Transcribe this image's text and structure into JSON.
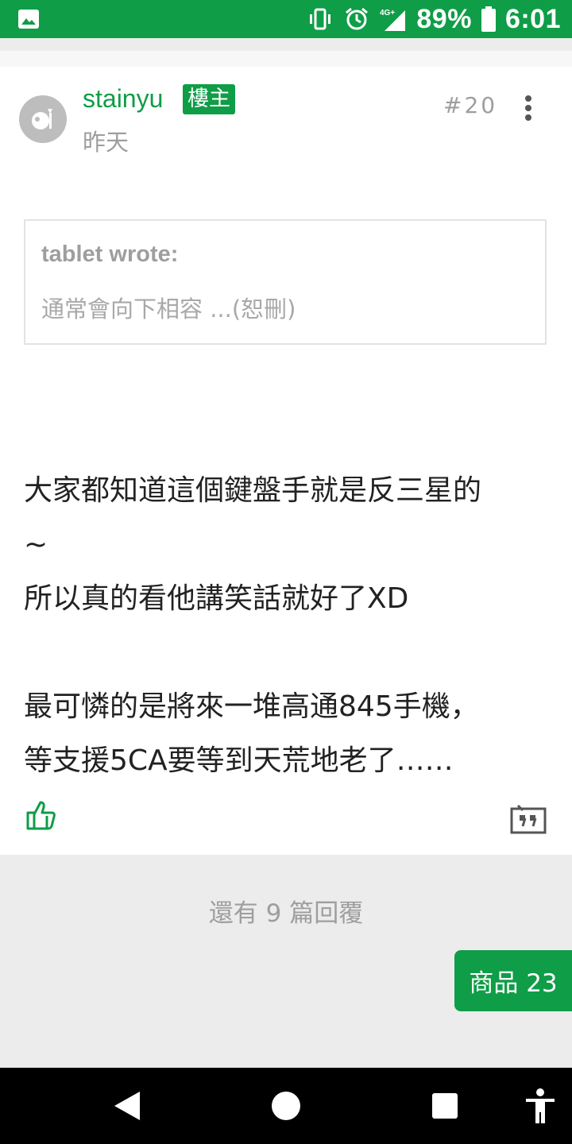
{
  "status_bar": {
    "left_icon": "gallery-notification-icon",
    "icons": [
      "vibrate-icon",
      "alarm-icon",
      "signal-4g-icon"
    ],
    "network": "4G+",
    "battery": "89%",
    "time": "6:01",
    "bg_color": "#0f9d47"
  },
  "post": {
    "username": "stainyu",
    "badge": "樓主",
    "time": "昨天",
    "floor": "#20",
    "quote": {
      "author": "tablet wrote:",
      "text": "通常會向下相容 ...(恕刪)"
    },
    "lines": [
      "大家都知道這個鍵盤手就是反三星的",
      "~",
      "所以真的看他講笑話就好了XD",
      "",
      "最可憐的是將來一堆高通845手機，",
      "等支援5CA要等到天荒地老了……"
    ]
  },
  "footer": {
    "more_replies": "還有 9 篇回覆",
    "goods_button": "商品 23"
  },
  "nav_bar": {
    "icons": [
      "back-icon",
      "home-icon",
      "recents-icon",
      "accessibility-icon"
    ]
  },
  "colors": {
    "accent": "#0f9d47",
    "muted": "#9e9e9e"
  }
}
